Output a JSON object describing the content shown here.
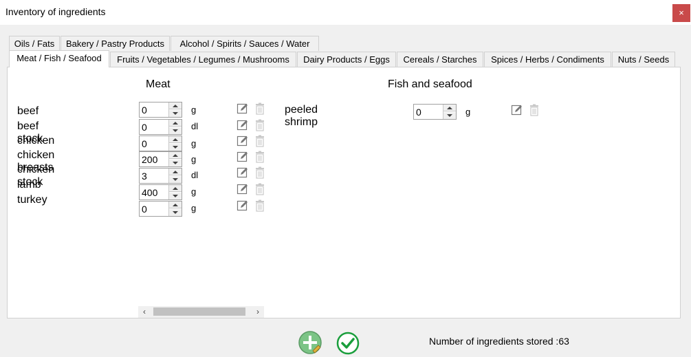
{
  "window": {
    "title": "Inventory of ingredients",
    "close_label": "×"
  },
  "tabs": {
    "row1": [
      "Oils / Fats",
      "Bakery / Pastry Products",
      "Alcohol / Spirits / Sauces / Water"
    ],
    "row2": [
      "Meat / Fish / Seafood",
      "Fruits / Vegetables / Legumes / Mushrooms",
      "Dairy Products / Eggs",
      "Cereals / Starches",
      "Spices / Herbs / Condiments",
      "Nuts / Seeds"
    ],
    "active": "Meat / Fish / Seafood"
  },
  "meat": {
    "heading": "Meat",
    "names": [
      "beef",
      "beef stock",
      "chicken",
      "chicken breasts",
      "chicken stock",
      "lamb",
      "turkey"
    ],
    "rows": [
      {
        "value": "0",
        "unit": "g"
      },
      {
        "value": "0",
        "unit": "dl"
      },
      {
        "value": "0",
        "unit": "g"
      },
      {
        "value": "200",
        "unit": "g"
      },
      {
        "value": "3",
        "unit": "dl"
      },
      {
        "value": "400",
        "unit": "g"
      },
      {
        "value": "0",
        "unit": "g"
      }
    ]
  },
  "fish": {
    "heading": "Fish and seafood",
    "names": [
      "peeled shrimp"
    ],
    "rows": [
      {
        "value": "0",
        "unit": "g"
      }
    ]
  },
  "scrollbar": {
    "left_arrow": "‹",
    "right_arrow": "›"
  },
  "status": {
    "text": "Number of ingredients stored :63"
  },
  "icons": {
    "edit": "edit-icon",
    "delete": "trash-icon",
    "add": "add-ingredient-icon",
    "confirm": "checkmark-icon"
  },
  "colors": {
    "close": "#c94a4a",
    "add": "#5fb36a",
    "confirm": "#1a9e3c"
  }
}
